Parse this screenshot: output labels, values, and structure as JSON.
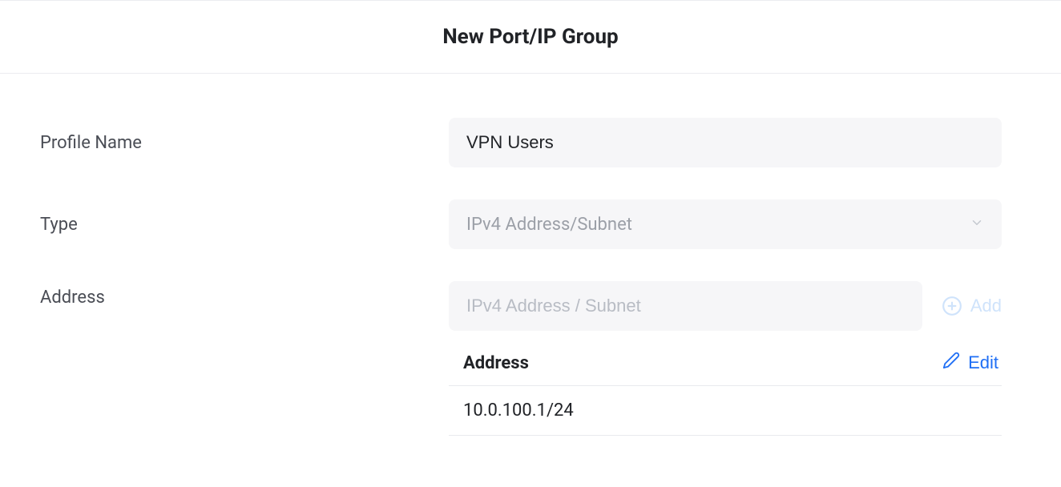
{
  "header": {
    "title": "New Port/IP Group"
  },
  "form": {
    "profileName": {
      "label": "Profile Name",
      "value": "VPN Users"
    },
    "type": {
      "label": "Type",
      "selected": "IPv4 Address/Subnet"
    },
    "address": {
      "label": "Address",
      "placeholder": "IPv4 Address / Subnet",
      "addLabel": "Add",
      "tableHeader": "Address",
      "editLabel": "Edit",
      "entries": [
        "10.0.100.1/24"
      ]
    }
  }
}
